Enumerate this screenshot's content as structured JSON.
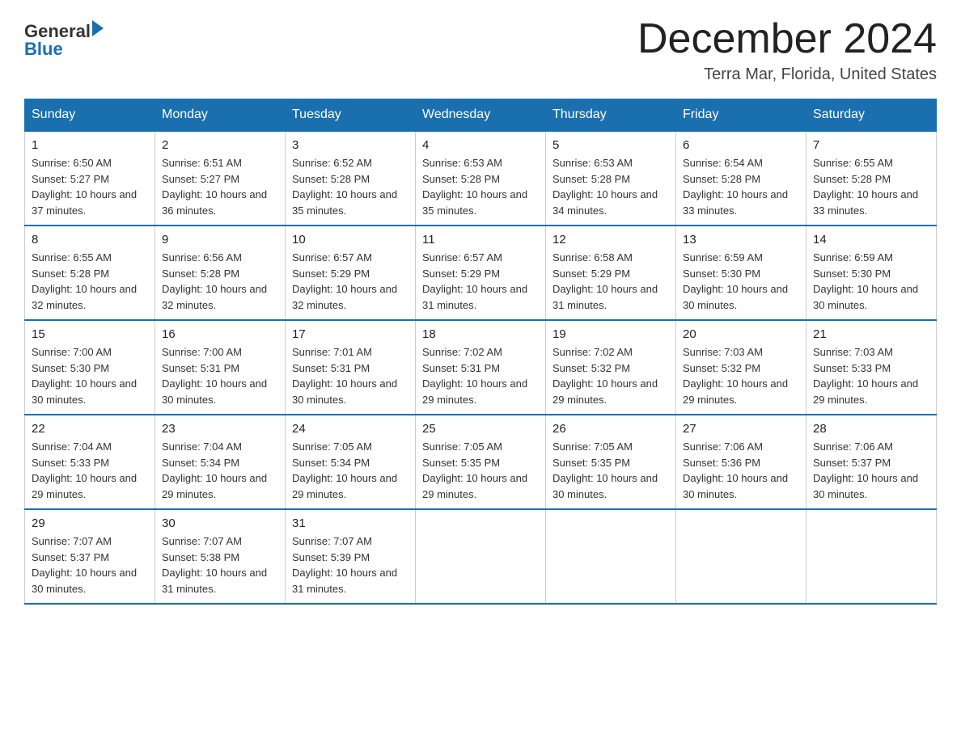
{
  "header": {
    "logo_general": "General",
    "logo_blue": "Blue",
    "month_title": "December 2024",
    "location": "Terra Mar, Florida, United States"
  },
  "days_of_week": [
    "Sunday",
    "Monday",
    "Tuesday",
    "Wednesday",
    "Thursday",
    "Friday",
    "Saturday"
  ],
  "weeks": [
    [
      {
        "day": "1",
        "sunrise": "6:50 AM",
        "sunset": "5:27 PM",
        "daylight": "10 hours and 37 minutes."
      },
      {
        "day": "2",
        "sunrise": "6:51 AM",
        "sunset": "5:27 PM",
        "daylight": "10 hours and 36 minutes."
      },
      {
        "day": "3",
        "sunrise": "6:52 AM",
        "sunset": "5:28 PM",
        "daylight": "10 hours and 35 minutes."
      },
      {
        "day": "4",
        "sunrise": "6:53 AM",
        "sunset": "5:28 PM",
        "daylight": "10 hours and 35 minutes."
      },
      {
        "day": "5",
        "sunrise": "6:53 AM",
        "sunset": "5:28 PM",
        "daylight": "10 hours and 34 minutes."
      },
      {
        "day": "6",
        "sunrise": "6:54 AM",
        "sunset": "5:28 PM",
        "daylight": "10 hours and 33 minutes."
      },
      {
        "day": "7",
        "sunrise": "6:55 AM",
        "sunset": "5:28 PM",
        "daylight": "10 hours and 33 minutes."
      }
    ],
    [
      {
        "day": "8",
        "sunrise": "6:55 AM",
        "sunset": "5:28 PM",
        "daylight": "10 hours and 32 minutes."
      },
      {
        "day": "9",
        "sunrise": "6:56 AM",
        "sunset": "5:28 PM",
        "daylight": "10 hours and 32 minutes."
      },
      {
        "day": "10",
        "sunrise": "6:57 AM",
        "sunset": "5:29 PM",
        "daylight": "10 hours and 32 minutes."
      },
      {
        "day": "11",
        "sunrise": "6:57 AM",
        "sunset": "5:29 PM",
        "daylight": "10 hours and 31 minutes."
      },
      {
        "day": "12",
        "sunrise": "6:58 AM",
        "sunset": "5:29 PM",
        "daylight": "10 hours and 31 minutes."
      },
      {
        "day": "13",
        "sunrise": "6:59 AM",
        "sunset": "5:30 PM",
        "daylight": "10 hours and 30 minutes."
      },
      {
        "day": "14",
        "sunrise": "6:59 AM",
        "sunset": "5:30 PM",
        "daylight": "10 hours and 30 minutes."
      }
    ],
    [
      {
        "day": "15",
        "sunrise": "7:00 AM",
        "sunset": "5:30 PM",
        "daylight": "10 hours and 30 minutes."
      },
      {
        "day": "16",
        "sunrise": "7:00 AM",
        "sunset": "5:31 PM",
        "daylight": "10 hours and 30 minutes."
      },
      {
        "day": "17",
        "sunrise": "7:01 AM",
        "sunset": "5:31 PM",
        "daylight": "10 hours and 30 minutes."
      },
      {
        "day": "18",
        "sunrise": "7:02 AM",
        "sunset": "5:31 PM",
        "daylight": "10 hours and 29 minutes."
      },
      {
        "day": "19",
        "sunrise": "7:02 AM",
        "sunset": "5:32 PM",
        "daylight": "10 hours and 29 minutes."
      },
      {
        "day": "20",
        "sunrise": "7:03 AM",
        "sunset": "5:32 PM",
        "daylight": "10 hours and 29 minutes."
      },
      {
        "day": "21",
        "sunrise": "7:03 AM",
        "sunset": "5:33 PM",
        "daylight": "10 hours and 29 minutes."
      }
    ],
    [
      {
        "day": "22",
        "sunrise": "7:04 AM",
        "sunset": "5:33 PM",
        "daylight": "10 hours and 29 minutes."
      },
      {
        "day": "23",
        "sunrise": "7:04 AM",
        "sunset": "5:34 PM",
        "daylight": "10 hours and 29 minutes."
      },
      {
        "day": "24",
        "sunrise": "7:05 AM",
        "sunset": "5:34 PM",
        "daylight": "10 hours and 29 minutes."
      },
      {
        "day": "25",
        "sunrise": "7:05 AM",
        "sunset": "5:35 PM",
        "daylight": "10 hours and 29 minutes."
      },
      {
        "day": "26",
        "sunrise": "7:05 AM",
        "sunset": "5:35 PM",
        "daylight": "10 hours and 30 minutes."
      },
      {
        "day": "27",
        "sunrise": "7:06 AM",
        "sunset": "5:36 PM",
        "daylight": "10 hours and 30 minutes."
      },
      {
        "day": "28",
        "sunrise": "7:06 AM",
        "sunset": "5:37 PM",
        "daylight": "10 hours and 30 minutes."
      }
    ],
    [
      {
        "day": "29",
        "sunrise": "7:07 AM",
        "sunset": "5:37 PM",
        "daylight": "10 hours and 30 minutes."
      },
      {
        "day": "30",
        "sunrise": "7:07 AM",
        "sunset": "5:38 PM",
        "daylight": "10 hours and 31 minutes."
      },
      {
        "day": "31",
        "sunrise": "7:07 AM",
        "sunset": "5:39 PM",
        "daylight": "10 hours and 31 minutes."
      },
      null,
      null,
      null,
      null
    ]
  ]
}
